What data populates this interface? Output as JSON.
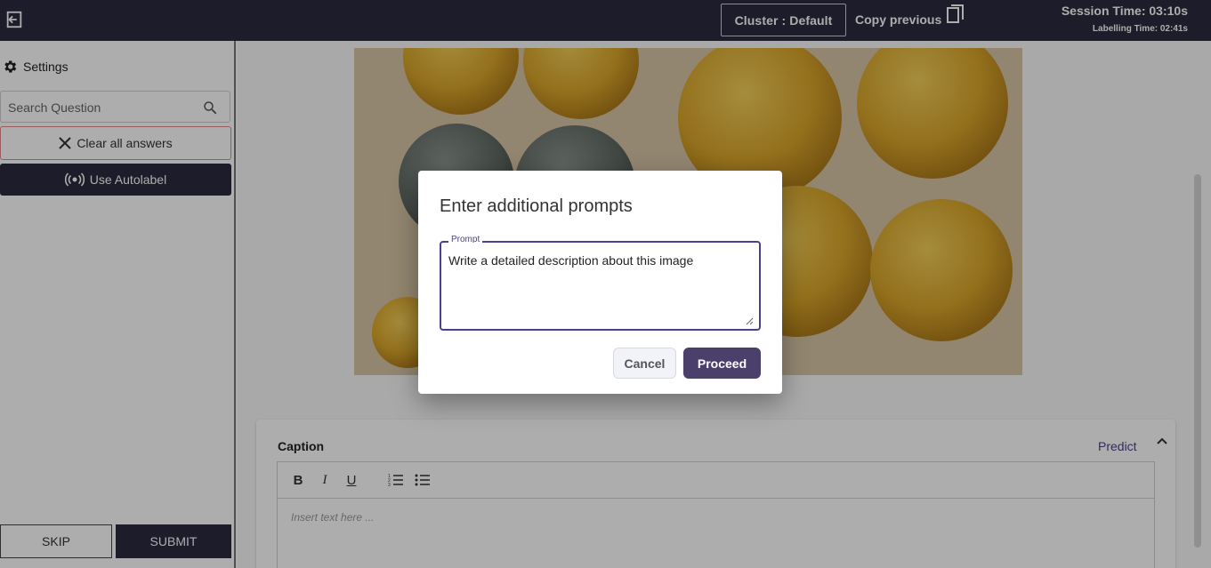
{
  "topbar": {
    "cluster_label": "Cluster : Default",
    "copy_previous_label": "Copy previous",
    "session_time": "Session Time: 03:10s",
    "labelling_time": "Labelling Time: 02:41s",
    "background_color": "#2a2a3f"
  },
  "sidebar": {
    "settings_label": "Settings",
    "search_placeholder": "Search Question",
    "clear_all_label": "Clear all answers",
    "autolabel_label": "Use Autolabel",
    "skip_label": "SKIP",
    "submit_label": "SUBMIT"
  },
  "main": {
    "caption": {
      "title": "Caption",
      "predict_label": "Predict",
      "editor_placeholder": "Insert text here ...",
      "toolbar": {
        "bold": "B",
        "italic": "I",
        "underline": "U"
      }
    }
  },
  "modal": {
    "title": "Enter additional prompts",
    "prompt_label": "Prompt",
    "prompt_value": "Write a detailed description about this image",
    "cancel_label": "Cancel",
    "proceed_label": "Proceed",
    "accent_color": "#4b3f6b"
  }
}
